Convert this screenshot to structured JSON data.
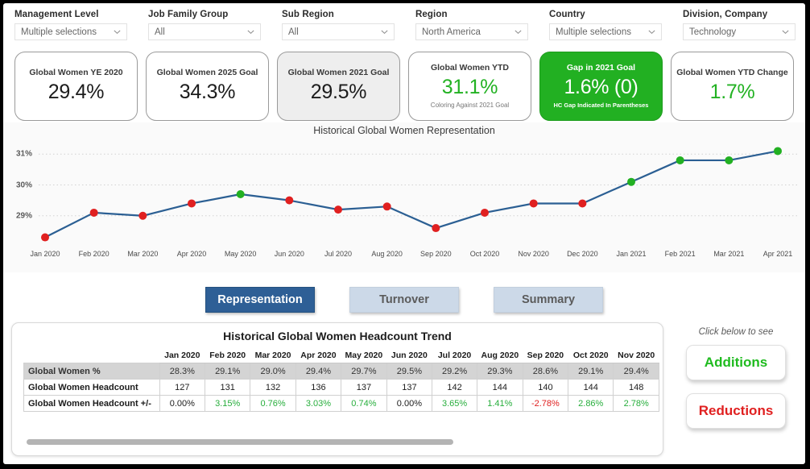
{
  "filters": [
    {
      "label": "Management Level",
      "value": "Multiple selections"
    },
    {
      "label": "Job Family Group",
      "value": "All"
    },
    {
      "label": "Sub Region",
      "value": "All"
    },
    {
      "label": "Region",
      "value": "North America"
    },
    {
      "label": "Country",
      "value": "Multiple selections"
    },
    {
      "label": "Division, Company",
      "value": "Technology"
    }
  ],
  "kpis": [
    {
      "title": "Global Women YE 2020",
      "value": "29.4%",
      "sub": "",
      "style": "plain"
    },
    {
      "title": "Global Women 2025 Goal",
      "value": "34.3%",
      "sub": "",
      "style": "plain"
    },
    {
      "title": "Global Women 2021 Goal",
      "value": "29.5%",
      "sub": "",
      "style": "shaded"
    },
    {
      "title": "Global Women YTD",
      "value": "31.1%",
      "sub": "Coloring Against 2021 Goal",
      "style": "green-text"
    },
    {
      "title": "Gap in 2021 Goal",
      "value": "1.6% (0)",
      "sub": "HC Gap Indicated In Parentheses",
      "style": "green"
    },
    {
      "title": "Global Women YTD Change",
      "value": "1.7%",
      "sub": "",
      "style": "green-text"
    }
  ],
  "chart_data": {
    "type": "line",
    "title": "Historical Global Women Representation",
    "xlabel": "",
    "ylabel": "",
    "ylim": [
      28.0,
      31.4
    ],
    "yticks": [
      29,
      30,
      31
    ],
    "ytick_labels": [
      "29%",
      "30%",
      "31%"
    ],
    "grid": true,
    "legend": "none",
    "accent_line": "#2b5f93",
    "marker_below_goal_color": "#e02020",
    "marker_at_or_above_goal_color": "#22b022",
    "categories": [
      "Jan 2020",
      "Feb 2020",
      "Mar 2020",
      "Apr 2020",
      "May 2020",
      "Jun 2020",
      "Jul 2020",
      "Aug 2020",
      "Sep 2020",
      "Oct 2020",
      "Nov 2020",
      "Dec 2020",
      "Jan 2021",
      "Feb 2021",
      "Mar 2021",
      "Apr 2021"
    ],
    "values": [
      28.3,
      29.1,
      29.0,
      29.4,
      29.7,
      29.5,
      29.2,
      29.3,
      28.6,
      29.1,
      29.4,
      29.4,
      30.1,
      30.8,
      30.8,
      31.1
    ],
    "marker_colors": [
      "#e02020",
      "#e02020",
      "#e02020",
      "#e02020",
      "#22b022",
      "#e02020",
      "#e02020",
      "#e02020",
      "#e02020",
      "#e02020",
      "#e02020",
      "#e02020",
      "#22b022",
      "#22b022",
      "#22b022",
      "#22b022"
    ]
  },
  "tabs": [
    {
      "label": "Representation",
      "active": true
    },
    {
      "label": "Turnover",
      "active": false
    },
    {
      "label": "Summary",
      "active": false
    }
  ],
  "table": {
    "title": "Historical Global Women Headcount Trend",
    "columns": [
      "Jan 2020",
      "Feb 2020",
      "Mar 2020",
      "Apr 2020",
      "May 2020",
      "Jun 2020",
      "Jul 2020",
      "Aug 2020",
      "Sep 2020",
      "Oct 2020",
      "Nov 2020"
    ],
    "rows": [
      {
        "label": "Global Women %",
        "shaded": true,
        "values": [
          "28.3%",
          "29.1%",
          "29.0%",
          "29.4%",
          "29.7%",
          "29.5%",
          "29.2%",
          "29.3%",
          "28.6%",
          "29.1%",
          "29.4%"
        ],
        "tones": [
          "zero",
          "zero",
          "zero",
          "zero",
          "zero",
          "zero",
          "zero",
          "zero",
          "zero",
          "zero",
          "zero"
        ]
      },
      {
        "label": "Global Women Headcount",
        "shaded": false,
        "values": [
          "127",
          "131",
          "132",
          "136",
          "137",
          "137",
          "142",
          "144",
          "140",
          "144",
          "148"
        ],
        "tones": [
          "zero",
          "zero",
          "zero",
          "zero",
          "zero",
          "zero",
          "zero",
          "zero",
          "zero",
          "zero",
          "zero"
        ]
      },
      {
        "label": "Global Women Headcount +/-",
        "shaded": false,
        "values": [
          "0.00%",
          "3.15%",
          "0.76%",
          "3.03%",
          "0.74%",
          "0.00%",
          "3.65%",
          "1.41%",
          "-2.78%",
          "2.86%",
          "2.78%"
        ],
        "tones": [
          "zero",
          "pos",
          "pos",
          "pos",
          "pos",
          "zero",
          "pos",
          "pos",
          "neg",
          "pos",
          "pos"
        ]
      }
    ]
  },
  "right_panel": {
    "hint": "Click below to see",
    "additions_label": "Additions",
    "reductions_label": "Reductions"
  }
}
